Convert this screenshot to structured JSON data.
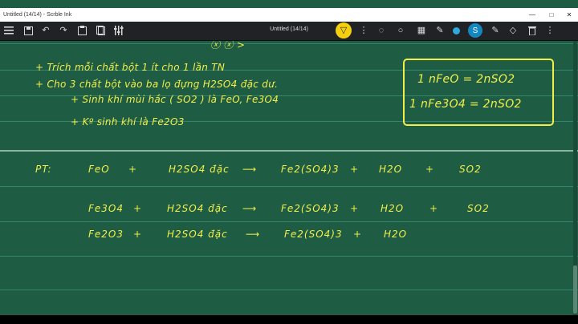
{
  "app": {
    "title": "Untitled (14/14) - Scrble Ink"
  },
  "window_controls": {
    "minimize": "—",
    "maximize": "□",
    "close": "✕"
  },
  "toolbar": {
    "document_title": "Untitled (14/14)",
    "icons": [
      "menu-icon",
      "save-icon",
      "undo-icon",
      "redo-icon",
      "clipboard-icon",
      "pages-icon",
      "equalizer-icon",
      "pen-icon",
      "dots-icon",
      "lasso-icon",
      "shapes-icon",
      "grid-icon",
      "color-icon",
      "pen-profile-icon",
      "pencil-icon",
      "eraser-icon",
      "trash-icon",
      "more-icon"
    ],
    "pen_profile_label": "S",
    "active_color": "#2fa9dc",
    "pen_tool_color": "#f3cf10"
  },
  "ink_color": "#f2ef4a",
  "notes": {
    "top_fragment": "ⓧ ⓧ >",
    "line1": "+ Trích mỗi chất bột 1 ít cho 1 lần TN",
    "line2": "+ Cho 3 chất bột vào ba lọ đựng H2SO4 đặc dư.",
    "line3": "+ Sinh khí mùi hắc ( SO2 ) là FeO, Fe3O4",
    "line4": "+ Kº sinh khí là Fe2O3"
  },
  "box": {
    "line1": "1 nFeO = 2nSO2",
    "line2": "1 nFe3O4 = 2nSO2"
  },
  "equations": {
    "label": "PT:",
    "eq1": [
      "FeO",
      "+",
      "H2SO4 đặc",
      "⟶",
      "Fe2(SO4)3",
      "+",
      "H2O",
      "+",
      "SO2"
    ],
    "eq2": [
      "Fe3O4",
      "+",
      "H2SO4 đặc",
      "⟶",
      "Fe2(SO4)3",
      "+",
      "H2O",
      "+",
      "SO2"
    ],
    "eq3": [
      "Fe2O3",
      "+",
      "H2SO4 đặc",
      "⟶",
      "Fe2(SO4)3",
      "+",
      "H2O"
    ]
  }
}
